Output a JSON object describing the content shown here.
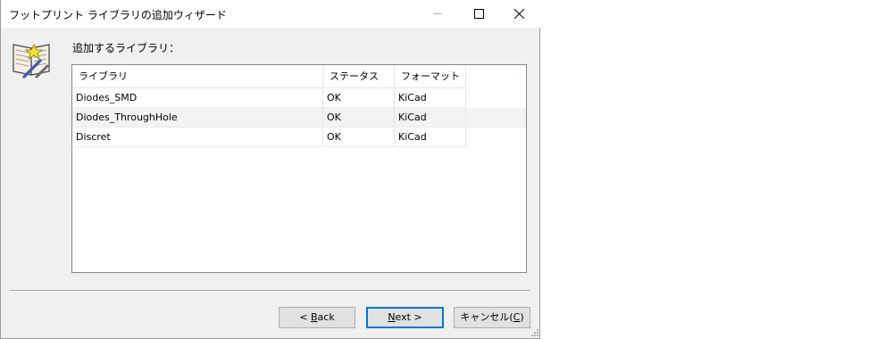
{
  "window": {
    "title": "フットプリント ライブラリの追加ウィザード"
  },
  "main": {
    "heading": "追加するライブラリ："
  },
  "table": {
    "columns": [
      "ライブラリ",
      "ステータス",
      "フォーマット"
    ],
    "rows": [
      {
        "library": "Diodes_SMD",
        "status": "OK",
        "format": "KiCad"
      },
      {
        "library": "Diodes_ThroughHole",
        "status": "OK",
        "format": "KiCad"
      },
      {
        "library": "Discret",
        "status": "OK",
        "format": "KiCad"
      }
    ]
  },
  "buttons": {
    "back": {
      "prefix": "< ",
      "mnemonic": "B",
      "rest": "ack"
    },
    "next": {
      "mnemonic": "N",
      "rest": "ext >"
    },
    "cancel": {
      "text": "キャンセル(",
      "mnemonic": "C",
      "suffix": ")"
    }
  },
  "icons": {
    "wizard": "book-wand-icon",
    "minimize": "minimize-icon",
    "maximize": "maximize-icon",
    "close": "close-icon"
  },
  "colors": {
    "window_bg": "#f0f0f0",
    "titlebar_bg": "#ffffff",
    "focus_border": "#0078d7",
    "alt_row": "#f3f3f3"
  }
}
